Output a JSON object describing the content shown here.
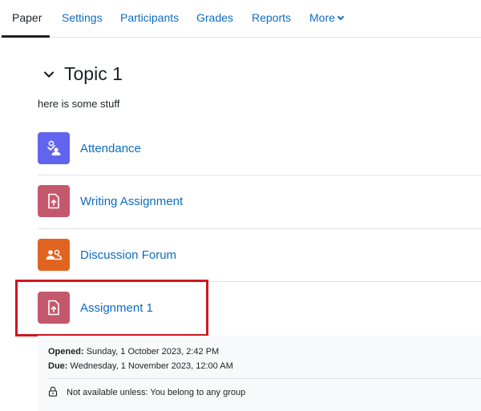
{
  "nav": {
    "items": [
      {
        "label": "Paper",
        "active": true
      },
      {
        "label": "Settings"
      },
      {
        "label": "Participants"
      },
      {
        "label": "Grades"
      },
      {
        "label": "Reports"
      },
      {
        "label": "More"
      }
    ]
  },
  "section": {
    "title": "Topic 1",
    "summary": "here is some stuff"
  },
  "activities": [
    {
      "name": "Attendance",
      "icon": "attendance-icon",
      "color": "#6264ee"
    },
    {
      "name": "Writing Assignment",
      "icon": "assignment-upload-icon",
      "color": "#c4586d"
    },
    {
      "name": "Discussion Forum",
      "icon": "forum-users-icon",
      "color": "#e0641f"
    },
    {
      "name": "Assignment 1",
      "icon": "assignment-upload-icon",
      "color": "#c4586d"
    }
  ],
  "assignment_details": {
    "opened_label": "Opened:",
    "opened_value": "Sunday, 1 October 2023, 2:42 PM",
    "due_label": "Due:",
    "due_value": "Wednesday, 1 November 2023, 12:00 AM",
    "restriction": "Not available unless: You belong to any group"
  },
  "colors": {
    "link": "#0f6cbf",
    "highlight": "#d0161c"
  }
}
